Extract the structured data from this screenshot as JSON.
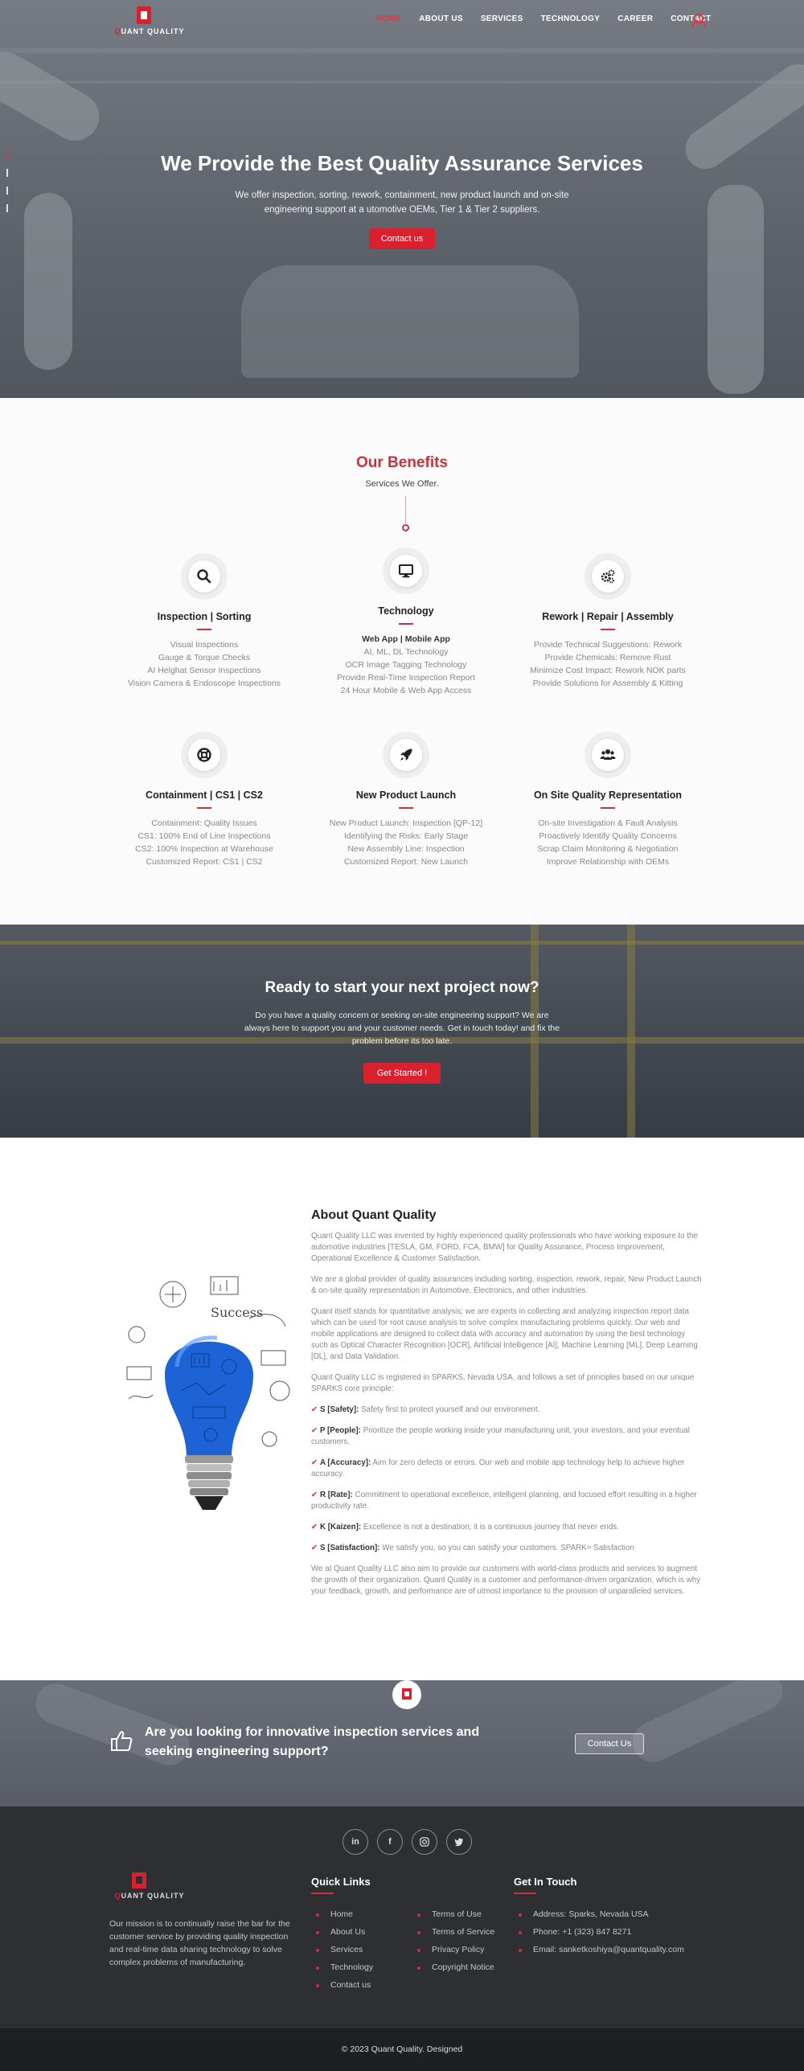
{
  "nav": {
    "logo_text_q": "Q",
    "logo_text_rest": "UANT QUALITY",
    "items": [
      "HOME",
      "ABOUT US",
      "SERVICES",
      "TECHNOLOGY",
      "CAREER",
      "CONTACT"
    ],
    "active": "HOME",
    "accent": "#e8323f"
  },
  "hero": {
    "title": "We Provide the Best Quality Assurance Services",
    "text": "We offer inspection, sorting, rework, containment, new product launch and on-site engineering support at a utomotive OEMs, Tier 1 & Tier 2 suppliers.",
    "button": "Contact us"
  },
  "benefits": {
    "title": "Our Benefits",
    "subtitle": "Services We Offer.",
    "cards": [
      {
        "icon": "search-icon",
        "title": "Inspection | Sorting",
        "lines": [
          "Visual Inspections",
          "Gauge & Torque Checks",
          "AI Helghat Sensor Inspections",
          "Vision Camera & Endoscope Inspections"
        ]
      },
      {
        "icon": "monitor-icon",
        "title": "Technology",
        "lines": [
          "Web App | Mobile App",
          "AI, ML, DL Technology",
          "OCR Image Tagging Technology",
          "Provide Real-Time Inspection Report",
          "24 Hour Mobile & Web App Access"
        ]
      },
      {
        "icon": "gears-icon",
        "title": "Rework | Repair | Assembly",
        "lines": [
          "Provide Technical Suggestions: Rework",
          "Provide Chemicals: Remove Rust",
          "Minimize Cost Impact: Rework NOK parts",
          "Provide Solutions for Assembly & Kitting"
        ]
      },
      {
        "icon": "lifebuoy-icon",
        "title": "Containment | CS1 | CS2",
        "lines": [
          "Containment: Quality Issues",
          "CS1: 100% End of Line Inspections",
          "CS2: 100% Inspection at Warehouse",
          "Customized Report: CS1 | CS2"
        ]
      },
      {
        "icon": "rocket-icon",
        "title": "New Product Launch",
        "lines": [
          "New Product Launch: Inspection [QP-12]",
          "Identifying the Risks: Early Stage",
          "New Assembly Line: Inspection",
          "Customized Report: New Launch"
        ]
      },
      {
        "icon": "users-icon",
        "title": "On Site Quality Representation",
        "lines": [
          "On-site Investigation & Fault Analysis",
          "Proactively Identify Quality Concerns",
          "Scrap Claim Monitoring & Negotiation",
          "Improve Relationship with OEMs"
        ]
      }
    ]
  },
  "ready": {
    "title": "Ready to start your next project now?",
    "text": "Do you have a quality concern or seeking on-site engineering support? We are always here to support you and your customer needs. Get in touch today! and fix the problem before its too late.",
    "button": "Get Started !"
  },
  "about": {
    "title": "About Quant Quality",
    "p1": "Quant Quality LLC was invented by highly experienced quality professionals who have working exposure to the automotive industries [TESLA, GM, FORD, FCA, BMW] for Quality Assurance, Process Improvement, Operational Excellence & Customer Satisfaction.",
    "p2": "We are a global provider of quality assurances including sorting, inspection, rework, repair, New Product Launch & on-site quality representation in Automotive, Electronics, and other industries.",
    "p3": "Quant itself stands for quantitative analysis; we are experts in collecting and analyzing inspection report data which can be used for root cause analysis to solve complex manufacturing problems quickly. Our web and mobile applications are designed to collect data with accuracy and automation by using the best technology such as Optical Character Recognition [OCR], Artificial Intelligence [AI], Machine Learning [ML], Deep Learning [DL], and Data Validation.",
    "p4": "Quant Quality LLC is registered in SPARKS, Nevada USA, and follows a set of principles based on our unique SPARKS core principle:",
    "principles": [
      {
        "key": "S [Safety]:",
        "text": "Safety first to protect yourself and our environment."
      },
      {
        "key": "P [People]:",
        "text": "Prioritize the people working inside your manufacturing unit, your investors, and your eventual customers."
      },
      {
        "key": "A [Accuracy]:",
        "text": "Aim for zero defects or errors. Our web and mobile app technology help to achieve higher accuracy."
      },
      {
        "key": "R [Rate]:",
        "text": "Commitment to operational excellence, intelligent planning, and focused effort resulting in a higher productivity rate."
      },
      {
        "key": "K [Kaizen]:",
        "text": "Excellence is not a destination; it is a continuous journey that never ends."
      },
      {
        "key": "S [Satisfaction]:",
        "text": "We satisfy you, so you can satisfy your customers. SPARK= Satisfaction"
      }
    ],
    "p5": "We at Quant Quality LLC also aim to provide our customers with world-class products and services to augment the growth of their organization. Quant Quality is a customer and performance-driven organization, which is why your feedback, growth, and performance are of utmost importance to the provision of unparalleled services.",
    "image_label": "Success"
  },
  "cta": {
    "text": "Are you looking for innovative inspection services and seeking engineering support?",
    "button": "Contact Us"
  },
  "footer": {
    "socials": [
      "in",
      "f",
      "ig",
      "tw"
    ],
    "mission": "Our mission is to continually raise the bar for the customer service by providing quality inspection and real-time data sharing technology to solve complex problems of manufacturing.",
    "quick_links_title": "Quick Links",
    "quick_links": [
      "Home",
      "About Us",
      "Services",
      "Technology",
      "Contact us"
    ],
    "legal_links": [
      "Terms of Use",
      "Terms of Service",
      "Privacy Policy",
      "Copyright Notice"
    ],
    "touch_title": "Get In Touch",
    "touch": [
      "Address: Sparks, Nevada USA",
      "Phone: +1 (323) 847 8271",
      "Email: sanketkoshiya@quantquality.com"
    ],
    "copyright": "© 2023 Quant Quality. Designed"
  }
}
